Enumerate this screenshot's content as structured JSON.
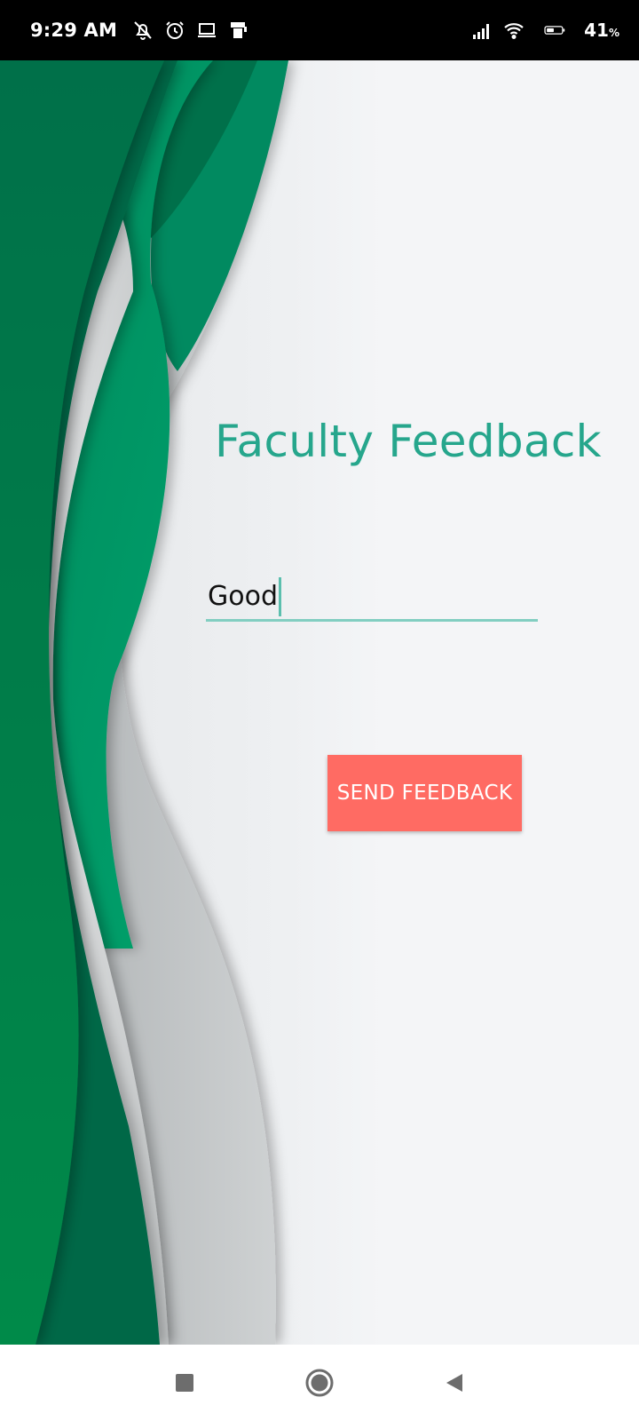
{
  "status_bar": {
    "time": "9:29 AM",
    "icons_left": [
      "bell-off-icon",
      "alarm-icon",
      "laptop-icon",
      "storage-icon"
    ],
    "icons_right": [
      "signal-icon",
      "wifi-icon",
      "battery-icon"
    ],
    "battery_percent": "41",
    "battery_unit": "%"
  },
  "app": {
    "title": "Faculty Feedback",
    "feedback_value": "Good",
    "send_button_label": "SEND FEEDBACK"
  },
  "colors": {
    "title": "#26a68c",
    "button": "#ff6b63",
    "field_underline": "#82cec1",
    "wave_dark_green": "#00704a",
    "wave_mid_green": "#009960"
  },
  "nav_bar": {
    "buttons": [
      "recents-square-icon",
      "home-circle-icon",
      "back-triangle-icon"
    ]
  }
}
